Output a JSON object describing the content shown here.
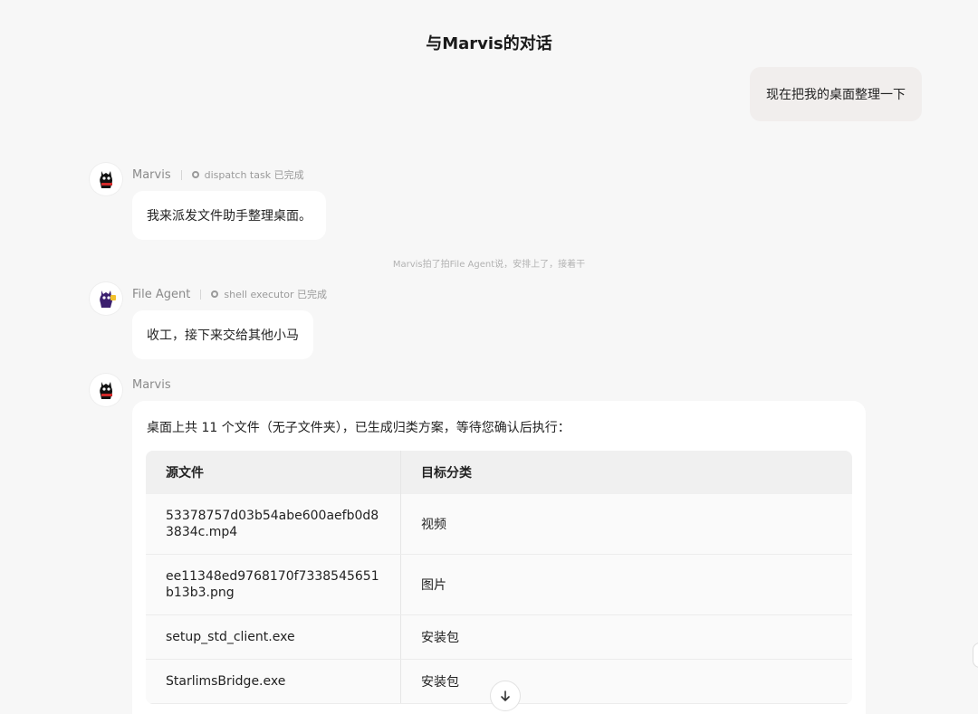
{
  "header": {
    "title": "与Marvis的对话"
  },
  "messages": {
    "user_1": {
      "text": "现在把我的桌面整理一下"
    },
    "marvis_1": {
      "sender": "Marvis",
      "task_label": "dispatch task 已完成",
      "text": "我来派发文件助手整理桌面。"
    },
    "system_note": "Marvis拍了拍File Agent说，安排上了，接着干",
    "agent_1": {
      "sender": "File Agent",
      "task_label": "shell executor 已完成",
      "text": "收工，接下来交给其他小马"
    },
    "marvis_2": {
      "sender": "Marvis",
      "intro": "桌面上共 11 个文件（无子文件夹），已生成归类方案，等待您确认后执行：",
      "table": {
        "headers": [
          "源文件",
          "目标分类"
        ],
        "rows": [
          {
            "file": "53378757d03b54abe600aefb0d83834c.mp4",
            "category": "视频"
          },
          {
            "file": "ee11348ed9768170f7338545651b13b3.png",
            "category": "图片"
          },
          {
            "file": "setup_std_client.exe",
            "category": "安装包"
          },
          {
            "file": "StarlimsBridge.exe",
            "category": "安装包"
          }
        ]
      }
    }
  },
  "icons": {
    "marvis_avatar": "horse-avatar-icon",
    "agent_avatar": "horse-avatar-icon",
    "task_status": "gear-icon",
    "scroll_down": "arrow-down-icon"
  },
  "colors": {
    "background": "#f7f7f7",
    "user_bubble": "#f1eeed",
    "bubble": "#ffffff",
    "table_header": "#f0f0f0"
  }
}
